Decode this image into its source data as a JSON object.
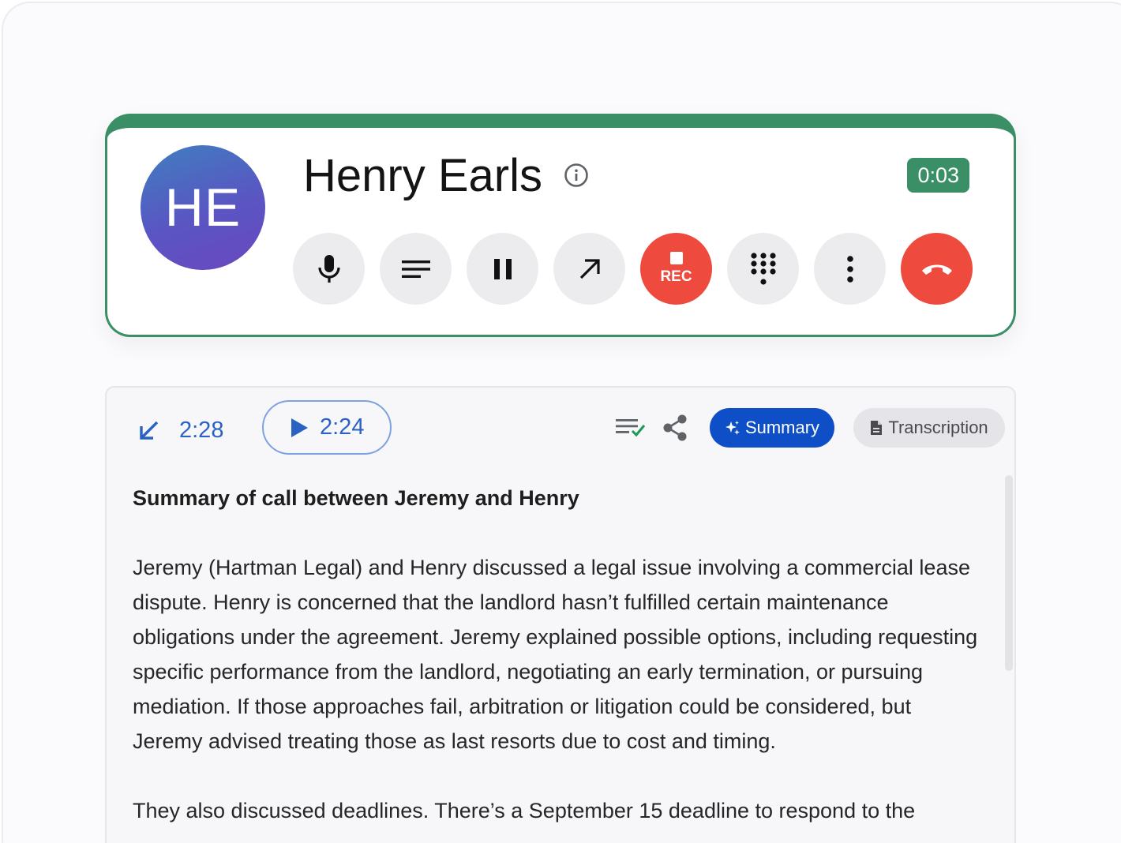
{
  "call": {
    "avatar_initials": "HE",
    "caller_name": "Henry Earls",
    "timer": "0:03",
    "controls": [
      {
        "name": "mute-button",
        "icon": "microphone-icon"
      },
      {
        "name": "notes-button",
        "icon": "lines-icon"
      },
      {
        "name": "hold-button",
        "icon": "pause-icon"
      },
      {
        "name": "transfer-button",
        "icon": "arrow-up-right-icon"
      },
      {
        "name": "record-button",
        "icon": "stop-icon",
        "label": "REC"
      },
      {
        "name": "keypad-button",
        "icon": "dialpad-icon"
      },
      {
        "name": "more-button",
        "icon": "more-vertical-icon"
      },
      {
        "name": "hangup-button",
        "icon": "phone-hangup-icon"
      }
    ],
    "colors": {
      "accent": "#3a8f67",
      "danger": "#ee4a3e",
      "avatar_gradient": [
        "#3f7fc0",
        "#6a47c0"
      ]
    }
  },
  "summary_panel": {
    "recording_length": "2:28",
    "playback_time": "2:24",
    "summary_tab_label": "Summary",
    "transcription_tab_label": "Transcription",
    "title": "Summary of call between Jeremy and Henry",
    "paragraphs": [
      "Jeremy (Hartman Legal) and Henry discussed a legal issue involving a commercial lease dispute. Henry is concerned that the landlord hasn’t fulfilled certain maintenance obligations under the agreement. Jeremy explained possible options, including requesting specific performance from the landlord, negotiating an early termination, or pursuing mediation. If those approaches fail, arbitration or litigation could be considered, but Jeremy advised treating those as last resorts due to cost and timing.",
      "They also discussed deadlines. There’s a September 15 deadline to respond to the"
    ],
    "colors": {
      "link_blue": "#2a62c4",
      "summary_button": "#0e4fc7"
    }
  }
}
